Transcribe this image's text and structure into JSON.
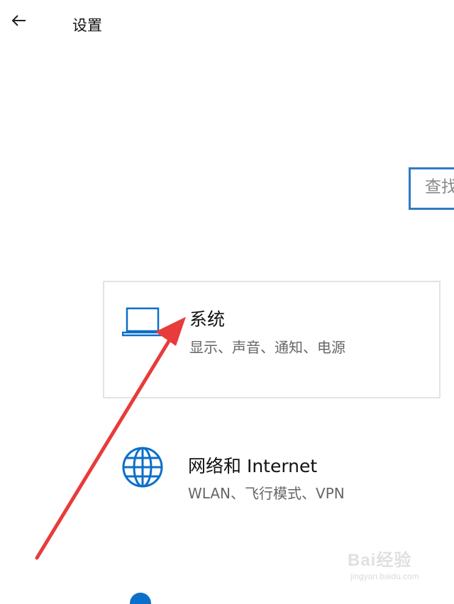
{
  "header": {
    "back_icon": "back-arrow-icon",
    "title": "设置"
  },
  "search": {
    "placeholder": "查找设置"
  },
  "categories": [
    {
      "icon": "laptop-icon",
      "title": "系统",
      "description": "显示、声音、通知、电源"
    },
    {
      "icon": "globe-icon",
      "title": "网络和 Internet",
      "description": "WLAN、飞行模式、VPN"
    }
  ],
  "annotation": {
    "type": "red-arrow",
    "color": "#e83b3b",
    "points_to": "系统"
  },
  "watermark": {
    "logo": "Bai经验",
    "url": "jingyan.baidu.com"
  },
  "colors": {
    "accent": "#0b6fc9",
    "search_border": "#2f7bc4",
    "arrow": "#e83b3b"
  }
}
